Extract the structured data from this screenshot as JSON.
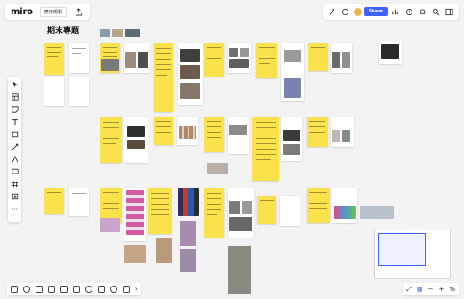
{
  "app": {
    "logo": "miro",
    "board_name": "應用規劃"
  },
  "header": {
    "share_label": "Share"
  },
  "board": {
    "title": "期末專題"
  },
  "colors": {
    "accent": "#4262ff",
    "sticky_yellow": "#f9e24b",
    "canvas": "#f3f3f3"
  },
  "left_toolbar": [
    "select-icon",
    "template-icon",
    "sticky-note-icon",
    "text-icon",
    "shape-icon",
    "connector-icon",
    "pen-icon",
    "comment-icon",
    "frame-icon",
    "upload-icon",
    "more-icon"
  ],
  "bottom_toolbar": [
    "frames-icon",
    "chat-icon",
    "grid-icon",
    "cards-icon",
    "present-icon",
    "share-screen-icon",
    "like-icon",
    "video-icon",
    "timer-icon",
    "vote-icon",
    "more-tools-icon"
  ],
  "zoom": {
    "minus": "−",
    "plus": "+",
    "level_label": "%"
  }
}
